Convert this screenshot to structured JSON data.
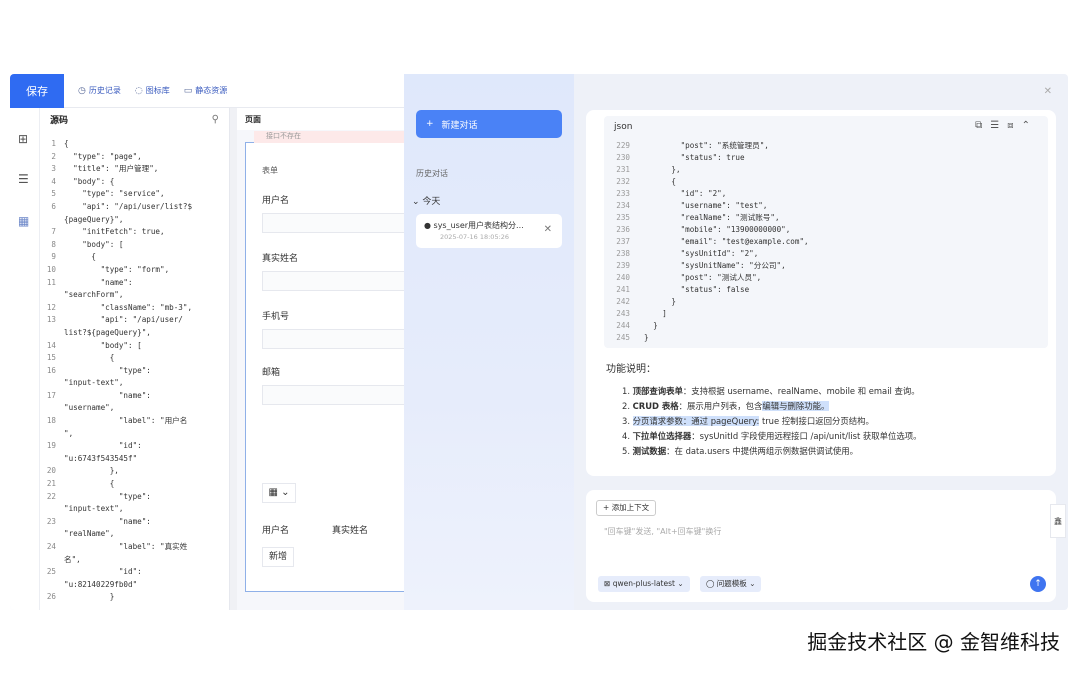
{
  "toolbar": {
    "save_label": "保存",
    "history_label": "历史记录",
    "icons_label": "图标库",
    "static_label": "静态资源"
  },
  "source_panel": {
    "title": "源码",
    "lines": [
      {
        "n": "1",
        "t": "{"
      },
      {
        "n": "2",
        "t": "  \"type\": \"page\","
      },
      {
        "n": "3",
        "t": "  \"title\": \"用户管理\","
      },
      {
        "n": "4",
        "t": "  \"body\": {"
      },
      {
        "n": "5",
        "t": "    \"type\": \"service\","
      },
      {
        "n": "6",
        "t": "    \"api\": \"/api/user/list?$"
      },
      {
        "n": "",
        "t": "{pageQuery}\","
      },
      {
        "n": "7",
        "t": "    \"initFetch\": true,"
      },
      {
        "n": "8",
        "t": "    \"body\": ["
      },
      {
        "n": "9",
        "t": "      {"
      },
      {
        "n": "10",
        "t": "        \"type\": \"form\","
      },
      {
        "n": "11",
        "t": "        \"name\":"
      },
      {
        "n": "",
        "t": "\"searchForm\","
      },
      {
        "n": "12",
        "t": "        \"className\": \"mb-3\","
      },
      {
        "n": "13",
        "t": "        \"api\": \"/api/user/"
      },
      {
        "n": "",
        "t": "list?${pageQuery}\","
      },
      {
        "n": "14",
        "t": "        \"body\": ["
      },
      {
        "n": "15",
        "t": "          {"
      },
      {
        "n": "16",
        "t": "            \"type\":"
      },
      {
        "n": "",
        "t": "\"input-text\","
      },
      {
        "n": "17",
        "t": "            \"name\":"
      },
      {
        "n": "",
        "t": "\"username\","
      },
      {
        "n": "18",
        "t": "            \"label\": \"用户名"
      },
      {
        "n": "",
        "t": "\","
      },
      {
        "n": "19",
        "t": "            \"id\":"
      },
      {
        "n": "",
        "t": "\"u:6743f543545f\""
      },
      {
        "n": "20",
        "t": "          },"
      },
      {
        "n": "21",
        "t": "          {"
      },
      {
        "n": "22",
        "t": "            \"type\":"
      },
      {
        "n": "",
        "t": "\"input-text\","
      },
      {
        "n": "23",
        "t": "            \"name\":"
      },
      {
        "n": "",
        "t": "\"realName\","
      },
      {
        "n": "24",
        "t": "            \"label\": \"真实姓"
      },
      {
        "n": "",
        "t": "名\","
      },
      {
        "n": "25",
        "t": "            \"id\":"
      },
      {
        "n": "",
        "t": "\"u:82140229fb0d\""
      },
      {
        "n": "26",
        "t": "          }"
      }
    ]
  },
  "page_panel": {
    "title": "页面",
    "warning": "接口不存在",
    "form_title": "表单",
    "fields": [
      "用户名",
      "真实姓名",
      "手机号",
      "邮箱"
    ],
    "table_headers": [
      "用户名",
      "真实姓名"
    ],
    "add_label": "新增"
  },
  "chat_sidebar": {
    "new_chat_label": "新建对话",
    "history_label": "历史对话",
    "today_label": "今天",
    "conversation_title": "sys_user用户表结构分...",
    "conversation_time": "2025-07-16 18:05:26"
  },
  "chat_main": {
    "code_lang": "json",
    "json_lines": [
      {
        "n": "229",
        "t": "        \"post\": \"系统管理员\","
      },
      {
        "n": "230",
        "t": "        \"status\": true"
      },
      {
        "n": "231",
        "t": "      },"
      },
      {
        "n": "232",
        "t": "      {"
      },
      {
        "n": "233",
        "t": "        \"id\": \"2\","
      },
      {
        "n": "234",
        "t": "        \"username\": \"test\","
      },
      {
        "n": "235",
        "t": "        \"realName\": \"测试账号\","
      },
      {
        "n": "236",
        "t": "        \"mobile\": \"13900000000\","
      },
      {
        "n": "237",
        "t": "        \"email\": \"test@example.com\","
      },
      {
        "n": "238",
        "t": "        \"sysUnitId\": \"2\","
      },
      {
        "n": "239",
        "t": "        \"sysUnitName\": \"分公司\","
      },
      {
        "n": "240",
        "t": "        \"post\": \"测试人员\","
      },
      {
        "n": "241",
        "t": "        \"status\": false"
      },
      {
        "n": "242",
        "t": "      }"
      },
      {
        "n": "243",
        "t": "    ]"
      },
      {
        "n": "244",
        "t": "  }"
      },
      {
        "n": "245",
        "t": "}"
      }
    ],
    "func_title": "功能说明：",
    "func_items": [
      {
        "num": "1.",
        "head": "顶部查询表单",
        "pre": "：支持根据 username、realName、mobile 和 email 查询。",
        "hl": "",
        "post": ""
      },
      {
        "num": "2.",
        "head": "CRUD 表格",
        "pre": "：展示用户列表，包含",
        "hl": "编辑与删除功能。",
        "post": ""
      },
      {
        "num": "3.",
        "head": "",
        "pre": "",
        "hl": "分页请求参数：通过 pageQuery:",
        "post": " true 控制接口返回分页结构。"
      },
      {
        "num": "4.",
        "head": "下拉单位选择器",
        "pre": "：sysUnitId 字段使用远程接口 /api/unit/list 获取单位选项。",
        "hl": "",
        "post": ""
      },
      {
        "num": "5.",
        "head": "测试数据",
        "pre": "：在 data.users 中提供两组示例数据供调试使用。",
        "hl": "",
        "post": ""
      }
    ],
    "add_context_label": "添加上下文",
    "input_placeholder": "\"回车键\"发送, \"Alt+回车键\"换行",
    "model_label": "qwen-plus-latest",
    "template_label": "问题模板"
  },
  "side_tab_label": "鑫",
  "watermark": "掘金技术社区 @ 金智维科技"
}
